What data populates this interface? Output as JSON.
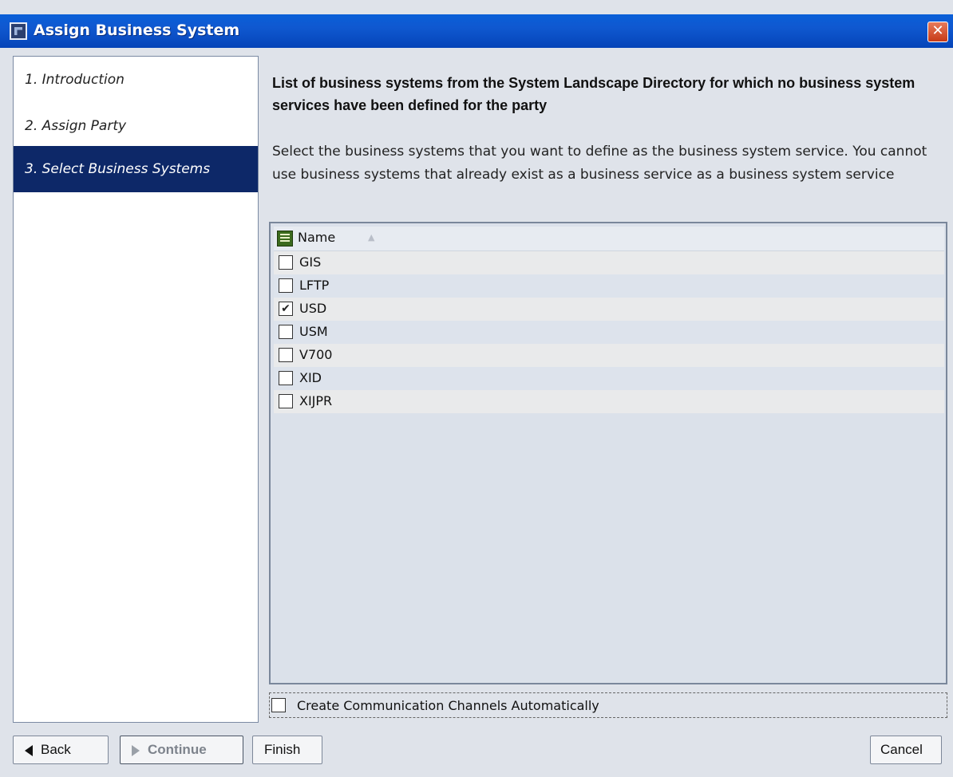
{
  "window": {
    "title": "Assign Business System",
    "close_label": "✕"
  },
  "steps": [
    {
      "label": "1. Introduction",
      "active": false
    },
    {
      "label": "2. Assign Party",
      "active": false
    },
    {
      "label": "3. Select Business Systems",
      "active": true
    }
  ],
  "content": {
    "heading": "List of business systems from the System Landscape Directory for which no business system services have been defined for the party",
    "description": "Select the business systems that you want to define as the business system service. You cannot use business systems that already exist as a business service as a business system service"
  },
  "table": {
    "column_header": "Name",
    "sort_indicator": "▲",
    "rows": [
      {
        "name": "GIS",
        "checked": false
      },
      {
        "name": "LFTP",
        "checked": false
      },
      {
        "name": "USD",
        "checked": true
      },
      {
        "name": "USM",
        "checked": false
      },
      {
        "name": "V700",
        "checked": false
      },
      {
        "name": "XID",
        "checked": false
      },
      {
        "name": "XIJPR",
        "checked": false
      }
    ]
  },
  "auto_channels": {
    "label": "Create Communication Channels Automatically",
    "checked": false
  },
  "buttons": {
    "back": "Back",
    "continue": "Continue",
    "finish": "Finish",
    "cancel": "Cancel"
  },
  "icons": {
    "window_icon": "wizard-icon",
    "column_chooser": "column-chooser-icon",
    "sort": "sort-ascending-icon",
    "back": "left-arrow-icon",
    "continue": "right-arrow-icon"
  }
}
